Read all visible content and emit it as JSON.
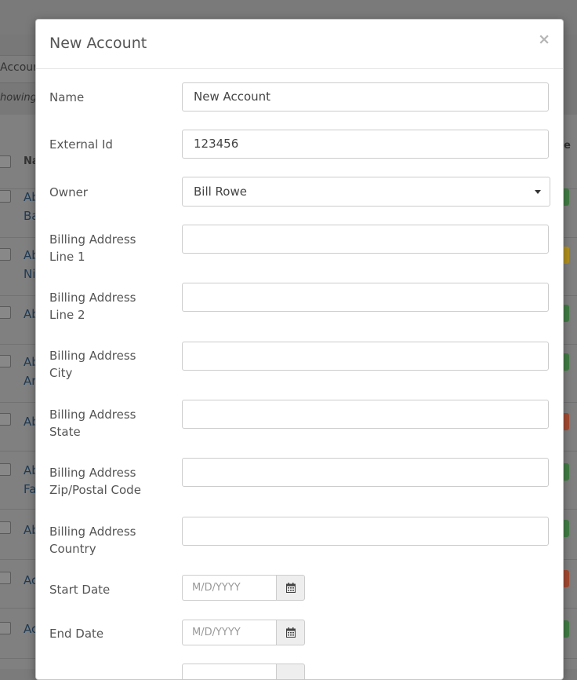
{
  "background": {
    "tab_label": "Accoun",
    "showing_text": "howing",
    "header_col": "Na",
    "header_right": "e",
    "rows": [
      {
        "line1": "Ab",
        "line2": "Ba",
        "status_color": "#2e7d32"
      },
      {
        "line1": "Ab",
        "line2": "Ni",
        "status_color": "#c49a00"
      },
      {
        "line1": "Ab",
        "line2": "",
        "status_color": "#2e7d32"
      },
      {
        "line1": "Ab",
        "line2": "Ar",
        "status_color": "#2e7d32"
      },
      {
        "line1": "Ab",
        "line2": "",
        "status_color": "#b23a1a"
      },
      {
        "line1": "Ab",
        "line2": "Fa",
        "status_color": "#2e7d32"
      },
      {
        "line1": "Ab",
        "line2": "",
        "status_color": "#2e7d32"
      },
      {
        "line1": "Ac",
        "line2": "",
        "status_color": "#b23a1a"
      },
      {
        "line1": "Ac",
        "line2": "",
        "status_color": "#2e7d32"
      }
    ]
  },
  "modal": {
    "title": "New Account",
    "close_glyph": "×",
    "fields": {
      "name": {
        "label": "Name",
        "value": "New Account"
      },
      "external_id": {
        "label": "External Id",
        "value": "123456"
      },
      "owner": {
        "label": "Owner",
        "value": "Bill Rowe"
      },
      "billing_line1": {
        "label_a": "Billing Address",
        "label_b": "Line 1",
        "value": ""
      },
      "billing_line2": {
        "label_a": "Billing Address",
        "label_b": "Line 2",
        "value": ""
      },
      "billing_city": {
        "label_a": "Billing Address",
        "label_b": "City",
        "value": ""
      },
      "billing_state": {
        "label_a": "Billing Address",
        "label_b": "State",
        "value": ""
      },
      "billing_zip": {
        "label_a": "Billing Address",
        "label_b": "Zip/Postal Code",
        "value": ""
      },
      "billing_country": {
        "label_a": "Billing Address",
        "label_b": "Country",
        "value": ""
      },
      "start_date": {
        "label": "Start Date",
        "placeholder": "M/D/YYYY"
      },
      "end_date": {
        "label": "End Date",
        "placeholder": "M/D/YYYY"
      }
    }
  }
}
